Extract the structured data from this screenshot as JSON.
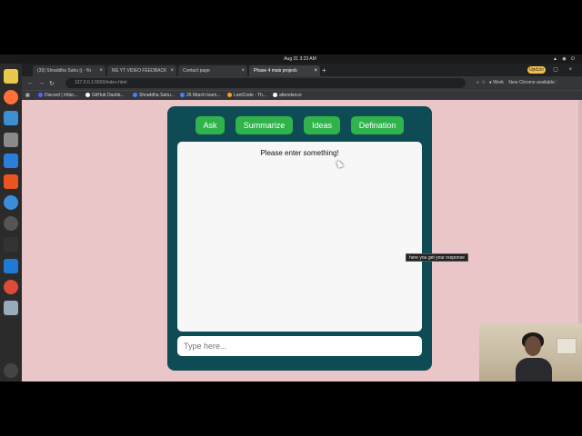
{
  "os": {
    "clock": "Aug 31  3:23 AM"
  },
  "tabs": [
    {
      "label": "(39) Shraddha Sahu || - Yo"
    },
    {
      "label": "NG YT VIDEO FEEDBACK"
    },
    {
      "label": "Contact page"
    },
    {
      "label": "Phase 4 mais projeck"
    }
  ],
  "browser": {
    "update_badge": "Update",
    "url": "127.0.0.1:5500/index.html",
    "profile": "Work",
    "new_chrome": "New Chrome available"
  },
  "bookmarks": [
    {
      "label": "Discord | #disc...",
      "color": "#5865f2"
    },
    {
      "label": "GitHub Dashb...",
      "color": "#ffffff"
    },
    {
      "label": "Shraddha Sahu...",
      "color": "#4285f4"
    },
    {
      "label": "26 March learn...",
      "color": "#4285f4"
    },
    {
      "label": "LeetCode - Th...",
      "color": "#f89f1b"
    },
    {
      "label": "attendence",
      "color": "#ffffff"
    }
  ],
  "app": {
    "buttons": {
      "ask": "Ask",
      "summarize": "Summarize",
      "ideas": "Ideas",
      "definition": "Defination"
    },
    "output_text": "Please enter something!",
    "input_placeholder": "Type here...",
    "tooltip": "here you get your response",
    "colors": {
      "page_bg": "#eac6c8",
      "card_bg": "#0f4b55",
      "button_bg": "#2fb34a"
    }
  }
}
